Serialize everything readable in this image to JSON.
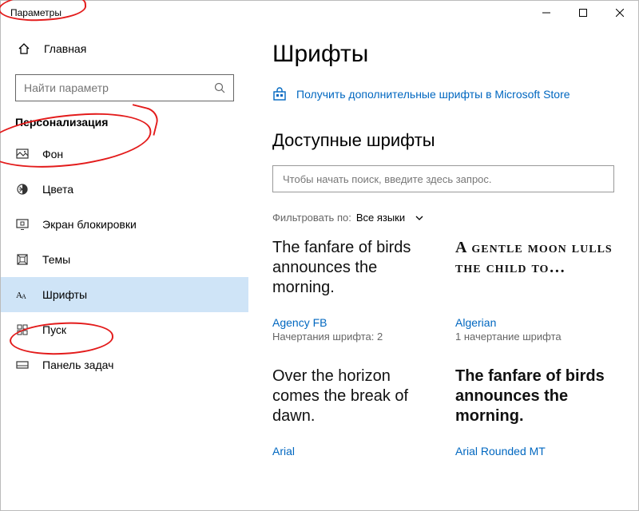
{
  "window_title": "Параметры",
  "home_label": "Главная",
  "search_placeholder": "Найти параметр",
  "category_title": "Персонализация",
  "nav": {
    "items": [
      {
        "label": "Фон"
      },
      {
        "label": "Цвета"
      },
      {
        "label": "Экран блокировки"
      },
      {
        "label": "Темы"
      },
      {
        "label": "Шрифты"
      },
      {
        "label": "Пуск"
      },
      {
        "label": "Панель задач"
      }
    ],
    "selected_index": 4
  },
  "page": {
    "title": "Шрифты",
    "store_link": "Получить дополнительные шрифты в Microsoft Store",
    "section_title": "Доступные шрифты",
    "font_search_placeholder": "Чтобы начать поиск, введите здесь запрос.",
    "filter_label": "Фильтровать по:",
    "filter_value": "Все языки"
  },
  "fonts": [
    {
      "sample": "The fanfare of birds announces the morning.",
      "name": "Agency FB",
      "meta": "Начертания шрифта: 2",
      "style": "s-agencyfb"
    },
    {
      "sample": "A gentle moon lulls the child to…",
      "name": "Algerian",
      "meta": "1 начертание шрифта",
      "style": "s-algerian"
    },
    {
      "sample": "Over the horizon comes the break of dawn.",
      "name": "Arial",
      "meta": "",
      "style": "s-arial"
    },
    {
      "sample": "The fanfare of birds announces the morning.",
      "name": "Arial Rounded MT",
      "meta": "",
      "style": "s-arialround"
    }
  ]
}
